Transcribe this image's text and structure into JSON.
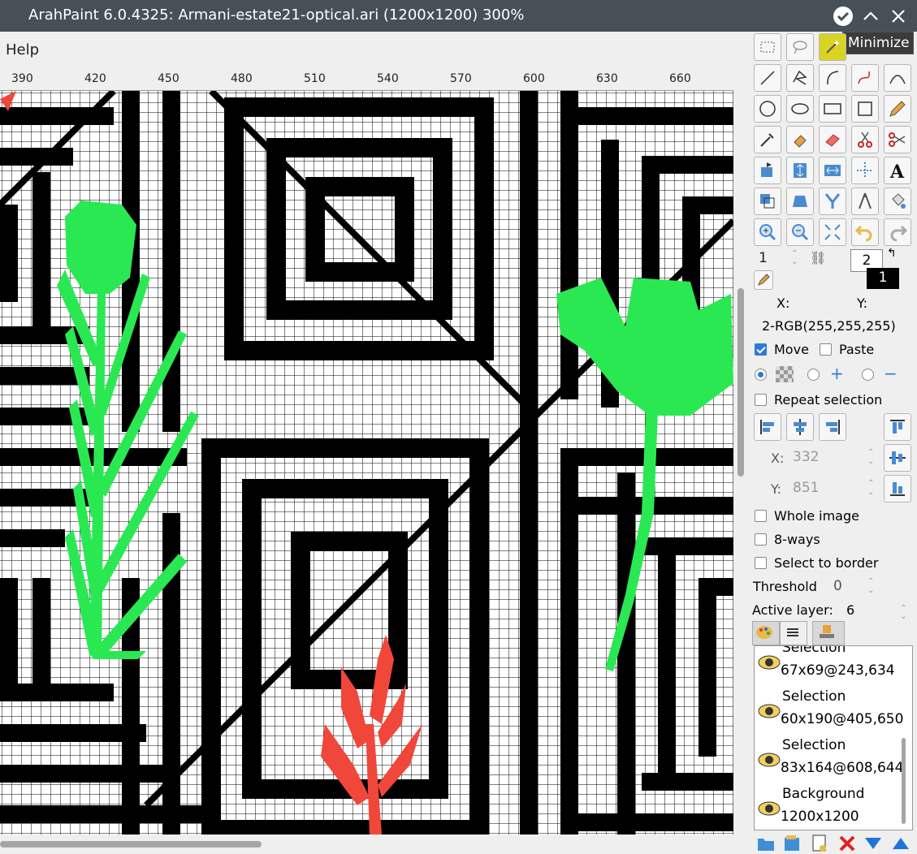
{
  "window": {
    "title": "ArahPaint 6.0.4325: Armani-estate21-optical.ari (1200x1200) 300%",
    "tooltip": "Minimize"
  },
  "menu": {
    "help": "Help"
  },
  "ruler": {
    "labels": [
      "390",
      "420",
      "450",
      "480",
      "510",
      "540",
      "570",
      "600",
      "630",
      "660"
    ]
  },
  "tools": {
    "rows": [
      [
        "rect-select-icon",
        "lasso-icon",
        "magic-wand-icon",
        "hidden"
      ],
      [
        "line-icon",
        "polyline-icon",
        "arc-icon",
        "curve-icon",
        "bezier-icon"
      ],
      [
        "circle-icon",
        "ellipse-icon",
        "rectangle-icon",
        "square-icon",
        "pencil-icon"
      ],
      [
        "color-picker-icon",
        "fill-icon",
        "eraser-icon",
        "scissors-icon",
        "scissors-alt-icon"
      ],
      [
        "rotate-icon",
        "flip-vertical-icon",
        "flip-horizontal-icon",
        "transform-icon",
        "text-icon"
      ],
      [
        "resize-icon",
        "perspective-icon",
        "y-tool-icon",
        "compass-icon",
        "bucket-icon"
      ],
      [
        "zoom-in-icon",
        "zoom-out-icon",
        "fit-icon",
        "undo-icon",
        "redo-icon"
      ]
    ]
  },
  "brush": {
    "size": "1",
    "color_fg": "2",
    "color_bg": "1"
  },
  "coords": {
    "x_label": "X:",
    "y_label": "Y:",
    "color_value": "2-RGB(255,255,255)"
  },
  "options": {
    "move": {
      "label": "Move",
      "checked": true
    },
    "paste": {
      "label": "Paste",
      "checked": false
    },
    "repeat_selection": "Repeat selection",
    "x_label": "X:",
    "x_value": "332",
    "y_label": "Y:",
    "y_value": "851",
    "whole_image": "Whole image",
    "eight_ways": "8-ways",
    "select_to_border": "Select to border",
    "threshold_label": "Threshold",
    "threshold_value": "0",
    "active_layer_label": "Active layer:",
    "active_layer_value": "6"
  },
  "layers": [
    {
      "name": "Selection",
      "info": "67x69@243,634"
    },
    {
      "name": "Selection",
      "info": "60x190@405,650"
    },
    {
      "name": "Selection",
      "info": "83x164@608,644"
    },
    {
      "name": "Background",
      "info": "1200x1200"
    }
  ],
  "colors": {
    "green": "#2ae852",
    "red": "#f0473a",
    "black": "#000000",
    "white": "#ffffff",
    "titlebar": "#475057",
    "active_tool": "#d9d324"
  }
}
